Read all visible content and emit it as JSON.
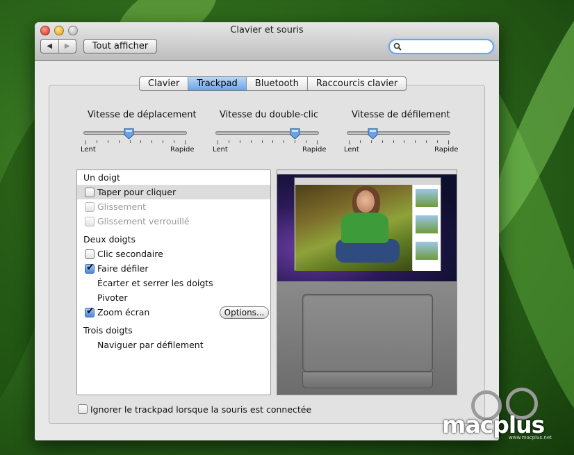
{
  "window": {
    "title": "Clavier et souris"
  },
  "toolbar": {
    "back_glyph": "◀",
    "forward_glyph": "▶",
    "show_all_label": "Tout afficher",
    "search_placeholder": ""
  },
  "tabs": [
    {
      "label": "Clavier",
      "active": false
    },
    {
      "label": "Trackpad",
      "active": true
    },
    {
      "label": "Bluetooth",
      "active": false
    },
    {
      "label": "Raccourcis clavier",
      "active": false
    }
  ],
  "sliders": [
    {
      "title": "Vitesse de déplacement",
      "min_label": "Lent",
      "max_label": "Rapide",
      "value": 0.44
    },
    {
      "title": "Vitesse du double-clic",
      "min_label": "Lent",
      "max_label": "Rapide",
      "value": 0.77
    },
    {
      "title": "Vitesse de défilement",
      "min_label": "Lent",
      "max_label": "Rapide",
      "value": 0.25
    }
  ],
  "gestures": {
    "one_finger_header": "Un doigt",
    "tap_to_click": {
      "label": "Taper pour cliquer",
      "checked": false
    },
    "dragging": {
      "label": "Glissement",
      "checked": false
    },
    "drag_lock": {
      "label": "Glissement verrouillé",
      "checked": false
    },
    "two_fingers_header": "Deux doigts",
    "secondary_click": {
      "label": "Clic secondaire",
      "checked": false
    },
    "scroll": {
      "label": "Faire défiler",
      "checked": true
    },
    "pinch": {
      "label": "Écarter et serrer les doigts"
    },
    "rotate": {
      "label": "Pivoter"
    },
    "screen_zoom": {
      "label": "Zoom écran",
      "checked": true,
      "options_label": "Options..."
    },
    "three_fingers_header": "Trois doigts",
    "swipe": {
      "label": "Naviguer par défilement"
    }
  },
  "ignore_trackpad": {
    "label": "Ignorer le trackpad lorsque la souris est connectée",
    "checked": false
  },
  "watermark": {
    "brand": "macplus",
    "url": "www.macplus.net"
  },
  "colors": {
    "accent": "#6ba4ea",
    "selection": "#dcdcdc"
  }
}
